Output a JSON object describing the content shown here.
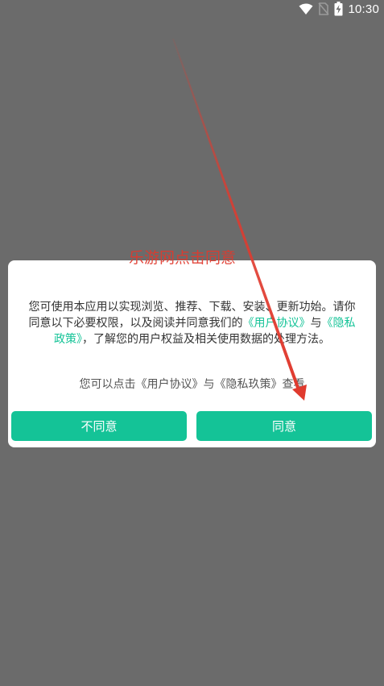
{
  "status_bar": {
    "time": "10:30",
    "icons": [
      "wifi-icon",
      "no-signal-icon",
      "battery-charging-icon"
    ]
  },
  "overlay_caption": "乐游网点击同意",
  "dialog": {
    "message_part1": "您可使用本应用以实现浏览、推荐、下载、安装、更新功始。请你同意以下必要权限，以及阅读并同意我们的",
    "link_user_agreement": "《用户协议》",
    "connector": "与",
    "link_privacy_policy": "《隐私政策》",
    "message_part2": "，了解您的用户权益及相关使用数据的处理方法。",
    "hint": "您可以点击《用户协议》与《隐私玖策》查看",
    "disagree_label": "不同意",
    "agree_label": "同意",
    "accent_color": "#14c397"
  },
  "annotation": {
    "arrow_color": "#e03a2e"
  }
}
